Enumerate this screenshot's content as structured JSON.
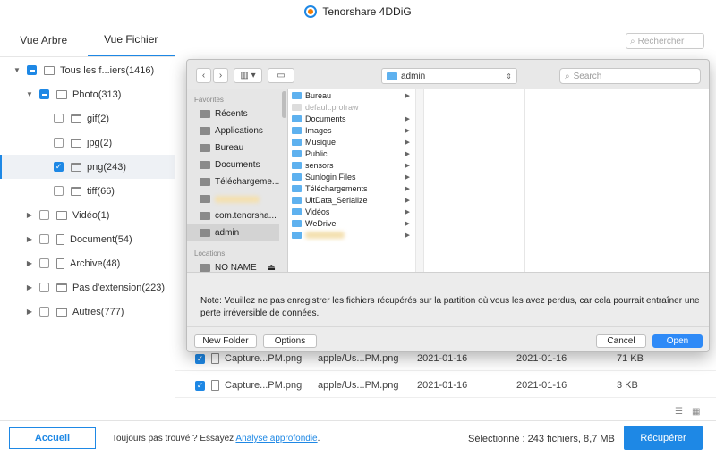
{
  "app": {
    "title": "Tenorshare 4DDiG"
  },
  "left_panel": {
    "tabs": [
      {
        "label": "Vue Arbre"
      },
      {
        "label": "Vue Fichier"
      }
    ],
    "tree": [
      {
        "label": "Tous les f...iers(1416)"
      },
      {
        "label": "Photo(313)"
      },
      {
        "label": "gif(2)"
      },
      {
        "label": "jpg(2)"
      },
      {
        "label": "png(243)"
      },
      {
        "label": "tiff(66)"
      },
      {
        "label": "Vidéo(1)"
      },
      {
        "label": "Document(54)"
      },
      {
        "label": "Archive(48)"
      },
      {
        "label": "Pas d'extension(223)"
      },
      {
        "label": "Autres(777)"
      }
    ]
  },
  "search": {
    "placeholder": "Rechercher"
  },
  "file_rows": [
    {
      "name": "Capture...PM.png",
      "path": "apple/Us...PM.png",
      "created": "2021-01-16",
      "modified": "2021-01-16",
      "size": "71 KB"
    },
    {
      "name": "Capture...PM.png",
      "path": "apple/Us...PM.png",
      "created": "2021-01-16",
      "modified": "2021-01-16",
      "size": "3 KB"
    }
  ],
  "bottom": {
    "home_label": "Accueil",
    "tip_text": "Toujours pas trouvé ? Essayez ",
    "tip_link": "Analyse approfondie",
    "tip_end": ".",
    "selection_info": "Sélectionné : 243 fichiers, 8,7 MB",
    "recover_label": "Récupérer"
  },
  "dialog": {
    "location": "admin",
    "search_placeholder": "Search",
    "sidebar": {
      "favorites_header": "Favorites",
      "favorites": [
        {
          "label": "Récents"
        },
        {
          "label": "Applications"
        },
        {
          "label": "Bureau"
        },
        {
          "label": "Documents"
        },
        {
          "label": "Téléchargeme..."
        },
        {
          "label": ""
        },
        {
          "label": "com.tenorsha..."
        },
        {
          "label": "admin"
        }
      ],
      "locations_header": "Locations",
      "locations": [
        {
          "label": "NO NAME"
        }
      ]
    },
    "folders": [
      {
        "label": "Bureau"
      },
      {
        "label": "default.profraw"
      },
      {
        "label": "Documents"
      },
      {
        "label": "Images"
      },
      {
        "label": "Musique"
      },
      {
        "label": "Public"
      },
      {
        "label": "sensors"
      },
      {
        "label": "Sunlogin Files"
      },
      {
        "label": "Téléchargements"
      },
      {
        "label": "UltData_Serialize"
      },
      {
        "label": "Vidéos"
      },
      {
        "label": "WeDrive"
      },
      {
        "label": ""
      }
    ],
    "note": "Note: Veuillez ne pas enregistrer les fichiers récupérés sur la partition où vous les avez perdus, car cela pourrait entraîner une perte irréversible de données.",
    "buttons": {
      "new_folder": "New Folder",
      "options": "Options",
      "cancel": "Cancel",
      "open": "Open"
    }
  }
}
